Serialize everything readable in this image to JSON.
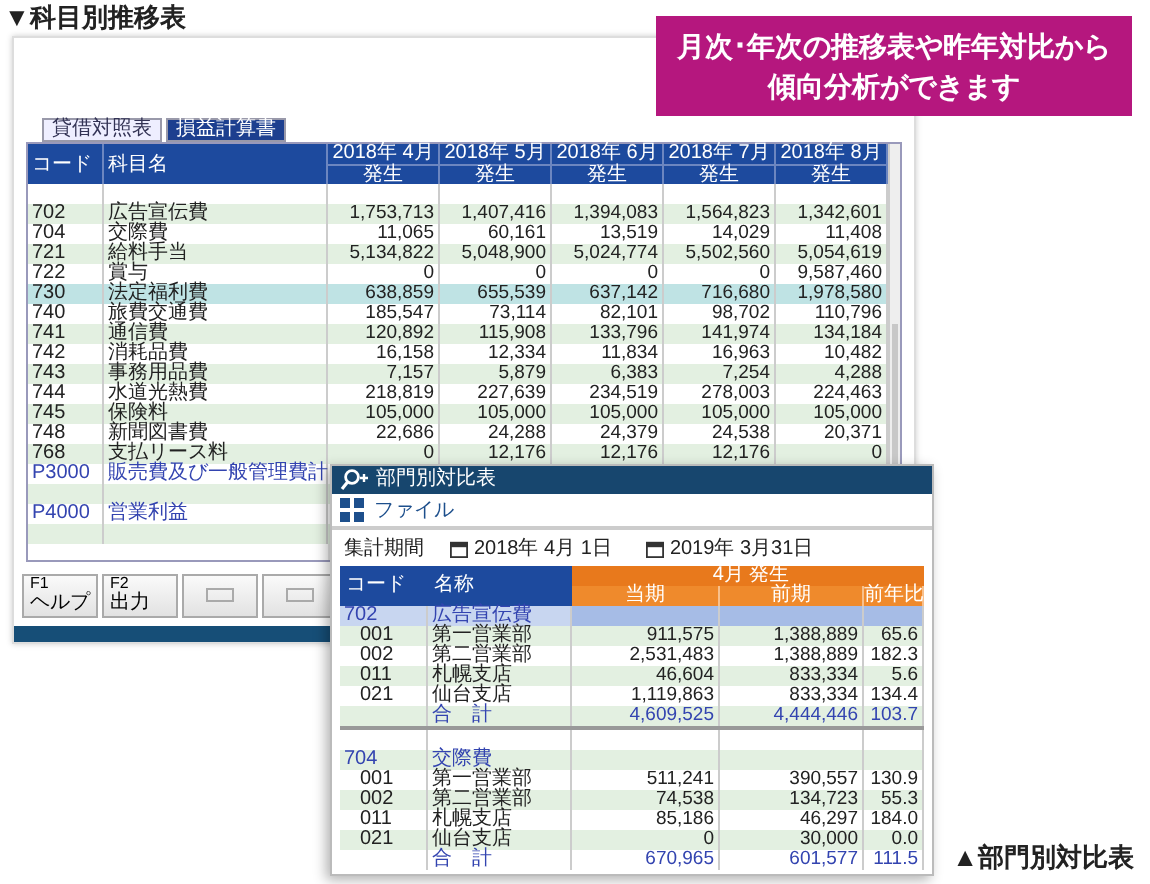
{
  "heading": "▼科目別推移表",
  "callout": {
    "lines": [
      "月次･年次の推移表や昨年対比から",
      "傾向分析ができます"
    ]
  },
  "trend_window": {
    "tabs": [
      {
        "label": "貸借対照表",
        "selected": false
      },
      {
        "label": "損益計算書",
        "selected": true
      }
    ],
    "columns": {
      "code": "コード",
      "name": "科目名",
      "months": [
        {
          "month": "2018年 4月",
          "sub": "発生"
        },
        {
          "month": "2018年 5月",
          "sub": "発生"
        },
        {
          "month": "2018年 6月",
          "sub": "発生"
        },
        {
          "month": "2018年 7月",
          "sub": "発生"
        },
        {
          "month": "2018年 8月",
          "sub": "発生"
        }
      ]
    },
    "rows": [
      {
        "kind": "blank",
        "selected": false
      },
      {
        "kind": "account",
        "code": "702",
        "name": "広告宣伝費",
        "values": [
          "1,753,713",
          "1,407,416",
          "1,394,083",
          "1,564,823",
          "1,342,601"
        ],
        "selected": false
      },
      {
        "kind": "account",
        "code": "704",
        "name": "交際費",
        "values": [
          "11,065",
          "60,161",
          "13,519",
          "14,029",
          "11,408"
        ],
        "selected": false
      },
      {
        "kind": "account",
        "code": "721",
        "name": "給料手当",
        "values": [
          "5,134,822",
          "5,048,900",
          "5,024,774",
          "5,502,560",
          "5,054,619"
        ],
        "selected": false
      },
      {
        "kind": "account",
        "code": "722",
        "name": "賞与",
        "values": [
          "0",
          "0",
          "0",
          "0",
          "9,587,460"
        ],
        "selected": false
      },
      {
        "kind": "account",
        "code": "730",
        "name": "法定福利費",
        "values": [
          "638,859",
          "655,539",
          "637,142",
          "716,680",
          "1,978,580"
        ],
        "selected": true
      },
      {
        "kind": "account",
        "code": "740",
        "name": "旅費交通費",
        "values": [
          "185,547",
          "73,114",
          "82,101",
          "98,702",
          "110,796"
        ],
        "selected": false
      },
      {
        "kind": "account",
        "code": "741",
        "name": "通信費",
        "values": [
          "120,892",
          "115,908",
          "133,796",
          "141,974",
          "134,184"
        ],
        "selected": false
      },
      {
        "kind": "account",
        "code": "742",
        "name": "消耗品費",
        "values": [
          "16,158",
          "12,334",
          "11,834",
          "16,963",
          "10,482"
        ],
        "selected": false
      },
      {
        "kind": "account",
        "code": "743",
        "name": "事務用品費",
        "values": [
          "7,157",
          "5,879",
          "6,383",
          "7,254",
          "4,288"
        ],
        "selected": false
      },
      {
        "kind": "account",
        "code": "744",
        "name": "水道光熱費",
        "values": [
          "218,819",
          "227,639",
          "234,519",
          "278,003",
          "224,463"
        ],
        "selected": false
      },
      {
        "kind": "account",
        "code": "745",
        "name": "保険料",
        "values": [
          "105,000",
          "105,000",
          "105,000",
          "105,000",
          "105,000"
        ],
        "selected": false
      },
      {
        "kind": "account",
        "code": "748",
        "name": "新聞図書費",
        "values": [
          "22,686",
          "24,288",
          "24,379",
          "24,538",
          "20,371"
        ],
        "selected": false
      },
      {
        "kind": "account",
        "code": "768",
        "name": "支払リース料",
        "values": [
          "0",
          "12,176",
          "12,176",
          "12,176",
          "0"
        ],
        "selected": false
      },
      {
        "kind": "subtotal",
        "code": "P3000",
        "name": "販売費及び一般管理費計",
        "selected": false
      },
      {
        "kind": "blank",
        "selected": false
      },
      {
        "kind": "subtotal",
        "code": "P4000",
        "name": "営業利益",
        "selected": false
      },
      {
        "kind": "blank",
        "selected": false
      }
    ],
    "function_keys": [
      {
        "key": "F1",
        "label": "ヘルプ"
      },
      {
        "key": "F2",
        "label": "出力"
      }
    ]
  },
  "comparison_window": {
    "title": "部門別対比表",
    "menu": "ファイル",
    "period_label": "集計期間",
    "date_from": "2018年 4月 1日",
    "date_to": "2019年 3月31日",
    "columns": {
      "code": "コード",
      "name": "名称",
      "group": "4月 発生",
      "values": [
        "当期",
        "前期",
        "前年比"
      ]
    },
    "rows": [
      {
        "kind": "group",
        "code": "702",
        "name": "広告宣伝費",
        "selected": true
      },
      {
        "kind": "detail",
        "code": "001",
        "name": "第一営業部",
        "values": [
          "911,575",
          "1,388,889",
          "65.6"
        ],
        "selected": false
      },
      {
        "kind": "detail",
        "code": "002",
        "name": "第二営業部",
        "values": [
          "2,531,483",
          "1,388,889",
          "182.3"
        ],
        "selected": false
      },
      {
        "kind": "detail",
        "code": "011",
        "name": "札幌支店",
        "values": [
          "46,604",
          "833,334",
          "5.6"
        ],
        "selected": false
      },
      {
        "kind": "detail",
        "code": "021",
        "name": "仙台支店",
        "values": [
          "1,119,863",
          "833,334",
          "134.4"
        ],
        "selected": false
      },
      {
        "kind": "total",
        "name": "合　計",
        "values": [
          "4,609,525",
          "4,444,446",
          "103.7"
        ],
        "selected": false
      },
      {
        "kind": "blank",
        "selected": false
      },
      {
        "kind": "group",
        "code": "704",
        "name": "交際費",
        "selected": false
      },
      {
        "kind": "detail",
        "code": "001",
        "name": "第一営業部",
        "values": [
          "511,241",
          "390,557",
          "130.9"
        ],
        "selected": false
      },
      {
        "kind": "detail",
        "code": "002",
        "name": "第二営業部",
        "values": [
          "74,538",
          "134,723",
          "55.3"
        ],
        "selected": false
      },
      {
        "kind": "detail",
        "code": "011",
        "name": "札幌支店",
        "values": [
          "85,186",
          "46,297",
          "184.0"
        ],
        "selected": false
      },
      {
        "kind": "detail",
        "code": "021",
        "name": "仙台支店",
        "values": [
          "0",
          "30,000",
          "0.0"
        ],
        "selected": false
      },
      {
        "kind": "total",
        "name": "合　計",
        "values": [
          "670,965",
          "601,577",
          "111.5"
        ],
        "selected": false
      }
    ]
  },
  "caption": "▲部門別対比表"
}
